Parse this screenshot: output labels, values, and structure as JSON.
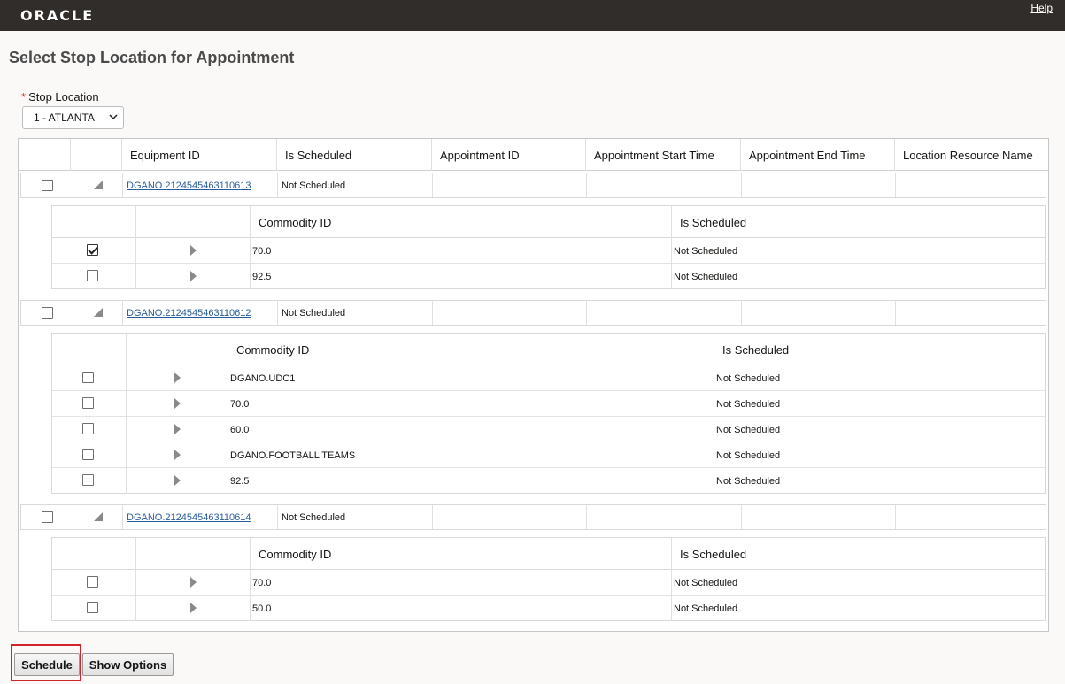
{
  "header": {
    "logo_text": "ORACLE",
    "help_label": "Help"
  },
  "page": {
    "title": "Select Stop Location for Appointment"
  },
  "stop_location": {
    "required_mark": "*",
    "label": "Stop Location",
    "selected": "1 - ATLANTA"
  },
  "table": {
    "columns": [
      "Equipment ID",
      "Is Scheduled",
      "Appointment ID",
      "Appointment Start Time",
      "Appointment End Time",
      "Location Resource Name"
    ],
    "sub_columns": [
      "Commodity ID",
      "Is Scheduled"
    ],
    "equipment": [
      {
        "id": "DGANO.2124545463110613",
        "is_scheduled": "Not Scheduled",
        "checked": false,
        "commodities": [
          {
            "id": "70.0",
            "is_scheduled": "Not Scheduled",
            "checked": true
          },
          {
            "id": "92.5",
            "is_scheduled": "Not Scheduled",
            "checked": false
          }
        ]
      },
      {
        "id": "DGANO.2124545463110612",
        "is_scheduled": "Not Scheduled",
        "checked": false,
        "commodities": [
          {
            "id": "DGANO.UDC1",
            "is_scheduled": "Not Scheduled",
            "checked": false
          },
          {
            "id": "70.0",
            "is_scheduled": "Not Scheduled",
            "checked": false
          },
          {
            "id": "60.0",
            "is_scheduled": "Not Scheduled",
            "checked": false
          },
          {
            "id": "DGANO.FOOTBALL TEAMS",
            "is_scheduled": "Not Scheduled",
            "checked": false
          },
          {
            "id": "92.5",
            "is_scheduled": "Not Scheduled",
            "checked": false
          }
        ]
      },
      {
        "id": "DGANO.2124545463110614",
        "is_scheduled": "Not Scheduled",
        "checked": false,
        "commodities": [
          {
            "id": "70.0",
            "is_scheduled": "Not Scheduled",
            "checked": false
          },
          {
            "id": "50.0",
            "is_scheduled": "Not Scheduled",
            "checked": false
          }
        ]
      }
    ]
  },
  "actions": {
    "schedule_label": "Schedule",
    "show_options_label": "Show Options"
  },
  "colors": {
    "topbar": "#312d2a",
    "link": "#2a5d9f",
    "highlight": "#d2232a"
  }
}
